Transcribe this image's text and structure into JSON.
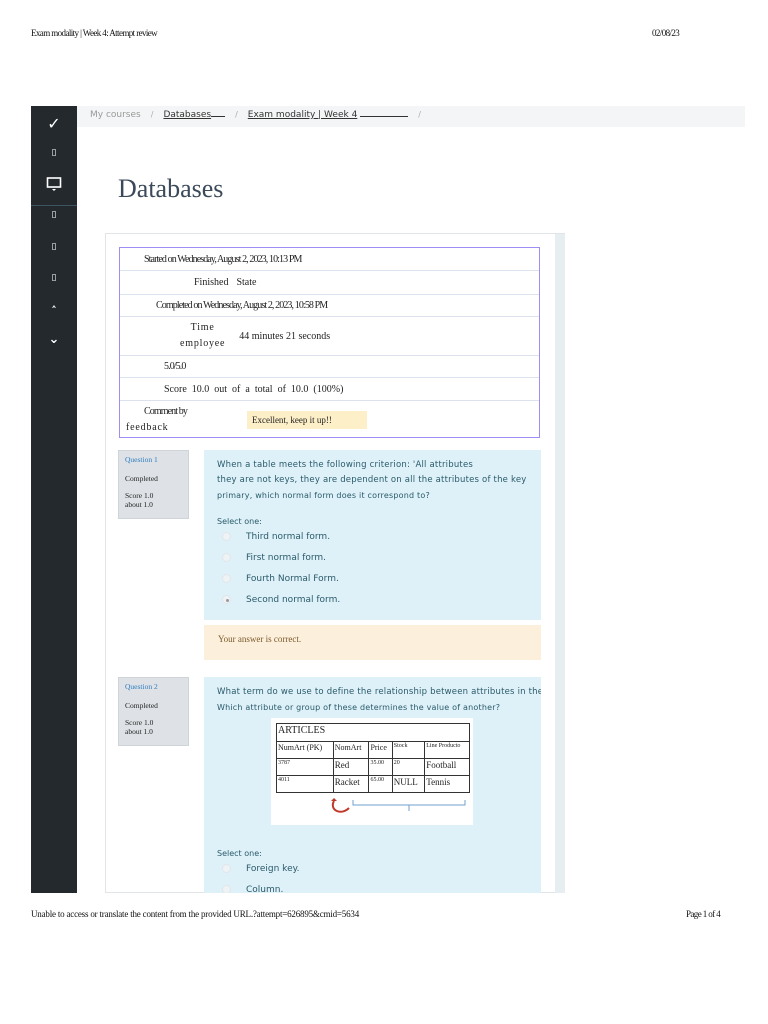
{
  "print_header": {
    "title": "Exam modality | Week 4: Attempt review",
    "date": "02/08/23"
  },
  "print_footer": {
    "url": "Unable to access or translate the content from the provided URL.?attempt=626895&cmid=5634",
    "page": "Page 1 of 4"
  },
  "sidebar": {
    "icons": [
      "check-icon",
      "square-icon",
      "monitor-icon",
      "square-icon",
      "square-icon",
      "square-icon",
      "chevron-up-icon",
      "chevron-down-icon"
    ]
  },
  "breadcrumb": {
    "items": [
      "My courses",
      "Databases",
      "Exam modality | Week 4"
    ],
    "separator": "/"
  },
  "page_title": "Databases",
  "summary": {
    "started": "Started on Wednesday, August 2, 2023, 10:13 PM",
    "state_label": "Finished",
    "state_value": "State",
    "completed": "Completed on Wednesday, August 2, 2023, 10:58 PM",
    "time_label_1": "Time",
    "time_label_2": "employee",
    "time_value": "44 minutes 21 seconds",
    "marks": "5.0/5.0",
    "grade": "Score  10.0  out  of  a  total  of  10.0  (100%)",
    "comment_label_1": "Comment by",
    "comment_label_2": "feedback",
    "comment_value": "Excellent, keep it up!!"
  },
  "questions": [
    {
      "number": "Question 1",
      "status": "Completed",
      "score": "Score 1.0",
      "about": "about 1.0",
      "text_1": "When a table meets the following criterion: 'All attributes",
      "text_2": "they are not keys, they are dependent on all the attributes of the key",
      "text_3": "primary, which normal form does it correspond to?",
      "select": "Select one:",
      "options": [
        "Third normal form.",
        "First normal form.",
        "Fourth Normal Form.",
        "Second normal form."
      ],
      "selected_index": 3,
      "feedback": "Your answer is correct."
    },
    {
      "number": "Question 2",
      "status": "Completed",
      "score": "Score 1.0",
      "about": "about 1.0",
      "text_1": "What term do we use to define the relationship between attributes in the",
      "text_2": "Which attribute or group of these determines the value of another?",
      "select": "Select one:",
      "options": [
        "Foreign key.",
        "Column."
      ],
      "figure": {
        "title": "ARTICLES",
        "headers": [
          "NumArt (PK)",
          "NomArt",
          "Price",
          "Stock",
          "Line Producto"
        ],
        "rows": [
          [
            "3787",
            "Red",
            "35.00",
            "20",
            "Football"
          ],
          [
            "4011",
            "Racket",
            "65.00",
            "NULL",
            "Tennis"
          ]
        ]
      }
    }
  ]
}
